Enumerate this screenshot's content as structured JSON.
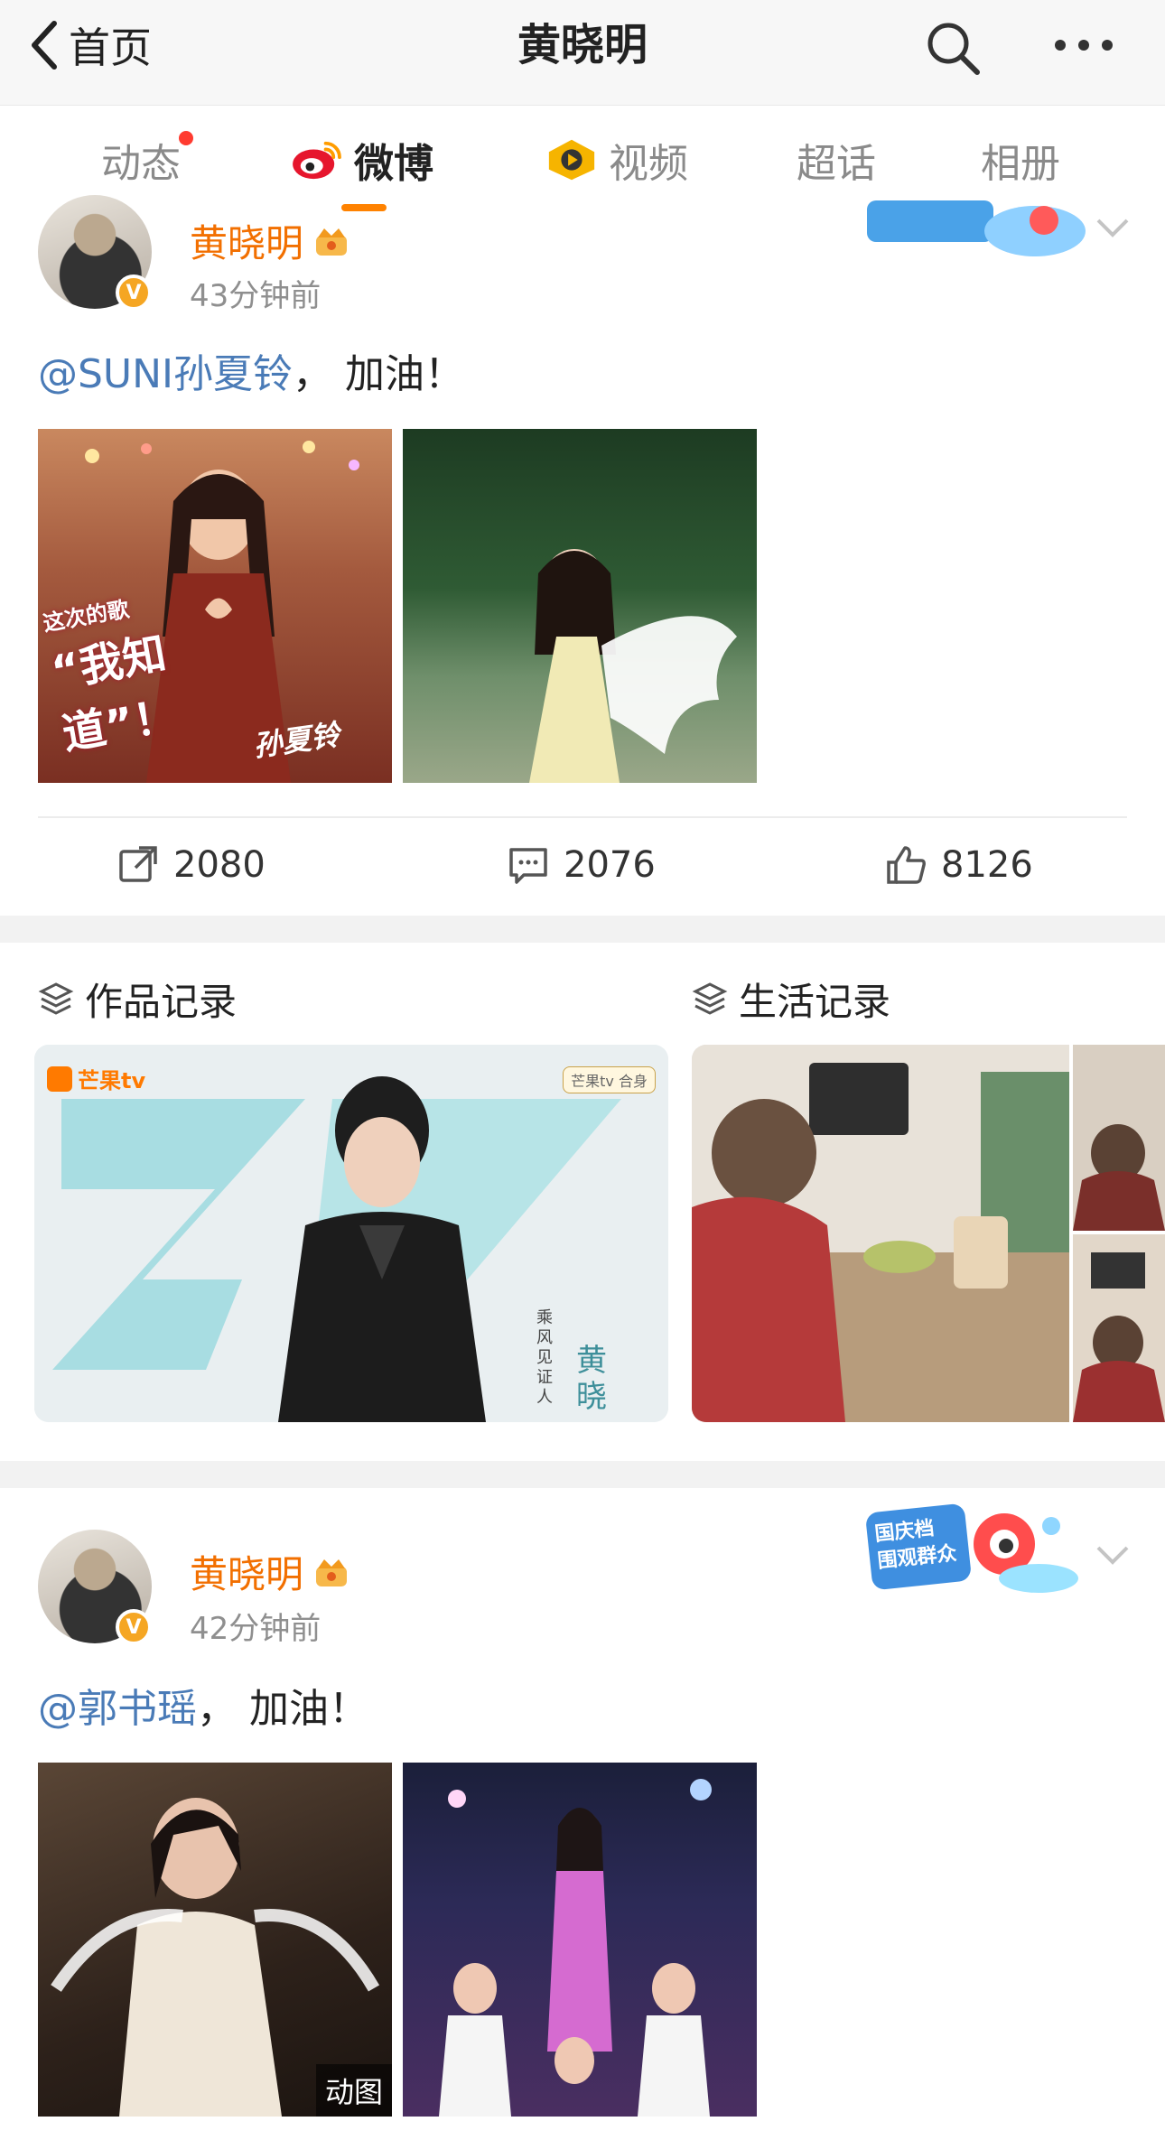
{
  "header": {
    "back_label": "首页",
    "title": "黄晓明"
  },
  "tabs": [
    {
      "label": "动态",
      "has_dot": true
    },
    {
      "label": "微博",
      "active": true
    },
    {
      "label": "视频"
    },
    {
      "label": "超话"
    },
    {
      "label": "相册"
    }
  ],
  "posts": [
    {
      "author": "黄晓明",
      "time": "43分钟前",
      "mention": "@SUNI孙夏铃",
      "text": "，  加油！",
      "images": [
        {
          "caption_lines": [
            "这次的歌",
            "“我知道”！",
            "孙夏铃"
          ]
        },
        {
          "caption_lines": []
        }
      ],
      "actions": {
        "repost": "2080",
        "comment": "2076",
        "like": "8126"
      }
    },
    {
      "author": "黄晓明",
      "time": "42分钟前",
      "mention": "@郭书瑶",
      "text": "，  加油！",
      "images": [
        {
          "badge": "动图"
        },
        {}
      ],
      "sticker_text": [
        "国庆档",
        "围观群众"
      ]
    }
  ],
  "albums": [
    {
      "title": "作品记录",
      "card_text": {
        "brand": "芒果tv",
        "side_a": "乘风见证人",
        "side_b": "黄晓",
        "corner": "芒果tv 合身"
      }
    },
    {
      "title": "生活记录"
    }
  ],
  "colors": {
    "accent_orange": "#ff8200",
    "username_orange": "#f26f00",
    "mention_blue": "#4a7bb7",
    "dot_red": "#ff3b30"
  }
}
